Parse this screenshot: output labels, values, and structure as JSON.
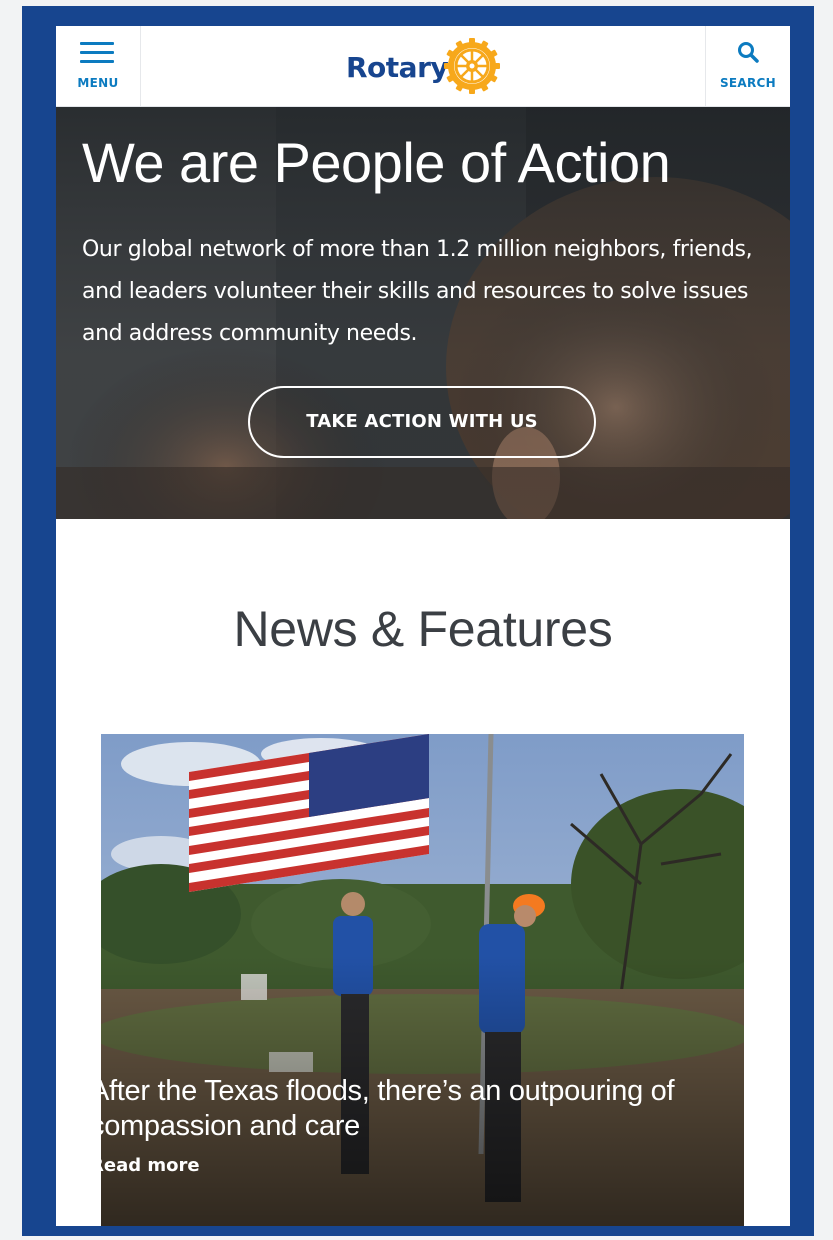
{
  "header": {
    "menu_label": "MENU",
    "brand_name": "Rotary",
    "search_label": "SEARCH"
  },
  "hero": {
    "title": "We are People of Action",
    "text": "Our global network of more than 1.2 million neighbors, friends, and leaders volunteer their skills and resources to solve issues and address community needs.",
    "cta_label": "TAKE ACTION WITH US"
  },
  "news": {
    "section_title": "News & Features",
    "card": {
      "headline": "After the Texas floods, there’s an outpouring of compassion and care",
      "read_more": "Read more"
    }
  },
  "colors": {
    "frame_blue": "#17458f",
    "link_blue": "#0c7bc0",
    "rotary_gold": "#f7a81b"
  },
  "icons": [
    "hamburger-menu-icon",
    "rotary-wheel-logo",
    "search-icon",
    "read-more-link"
  ]
}
